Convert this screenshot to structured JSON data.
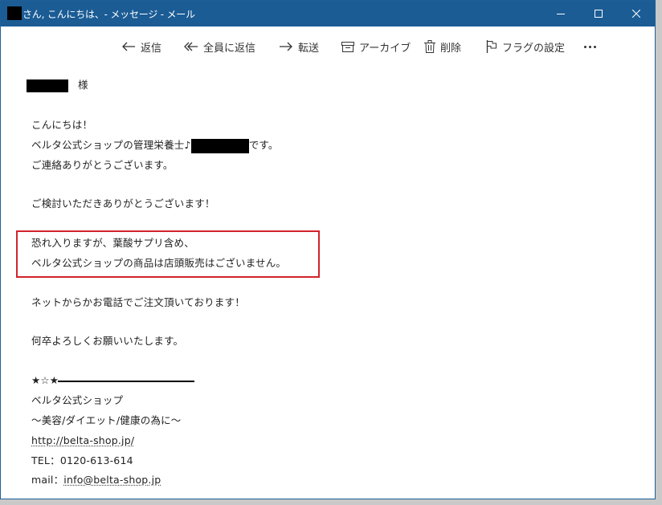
{
  "titlebar": {
    "title": "さん, こんにちは、- メッセージ - メール"
  },
  "toolbar": {
    "reply": "返信",
    "reply_all": "全員に返信",
    "forward": "転送",
    "archive": "アーカイブ",
    "delete": "削除",
    "flag": "フラグの設定"
  },
  "message": {
    "salutation_suffix": "様",
    "greeting": "こんにちは！",
    "intro_before": "ベルタ公式ショップの管理栄養士♪",
    "intro_after": "です。",
    "thanks_contact": "ご連絡ありがとうございます。",
    "thanks_consider": "ご検討いただきありがとうございます！",
    "highlight_line1": "恐れ入りますが、葉酸サプリ含め、",
    "highlight_line2": "ベルタ公式ショップの商品は店頭販売はございません。",
    "online_order": "ネットからかお電話でご注文頂いております！",
    "closing": "何卒よろしくお願いいたします。"
  },
  "signature": {
    "stars": "★☆★",
    "shop_name": "ベルタ公式ショップ",
    "tagline": "～美容/ダイエット/健康の為に～",
    "url": "http://belta-shop.jp/",
    "tel_label": "TEL：",
    "tel": "0120-613-614",
    "mail_label": "mail：",
    "mail": "info@belta-shop.jp"
  },
  "colors": {
    "titlebar": "#1b5c95",
    "highlight_border": "#d3232b"
  }
}
